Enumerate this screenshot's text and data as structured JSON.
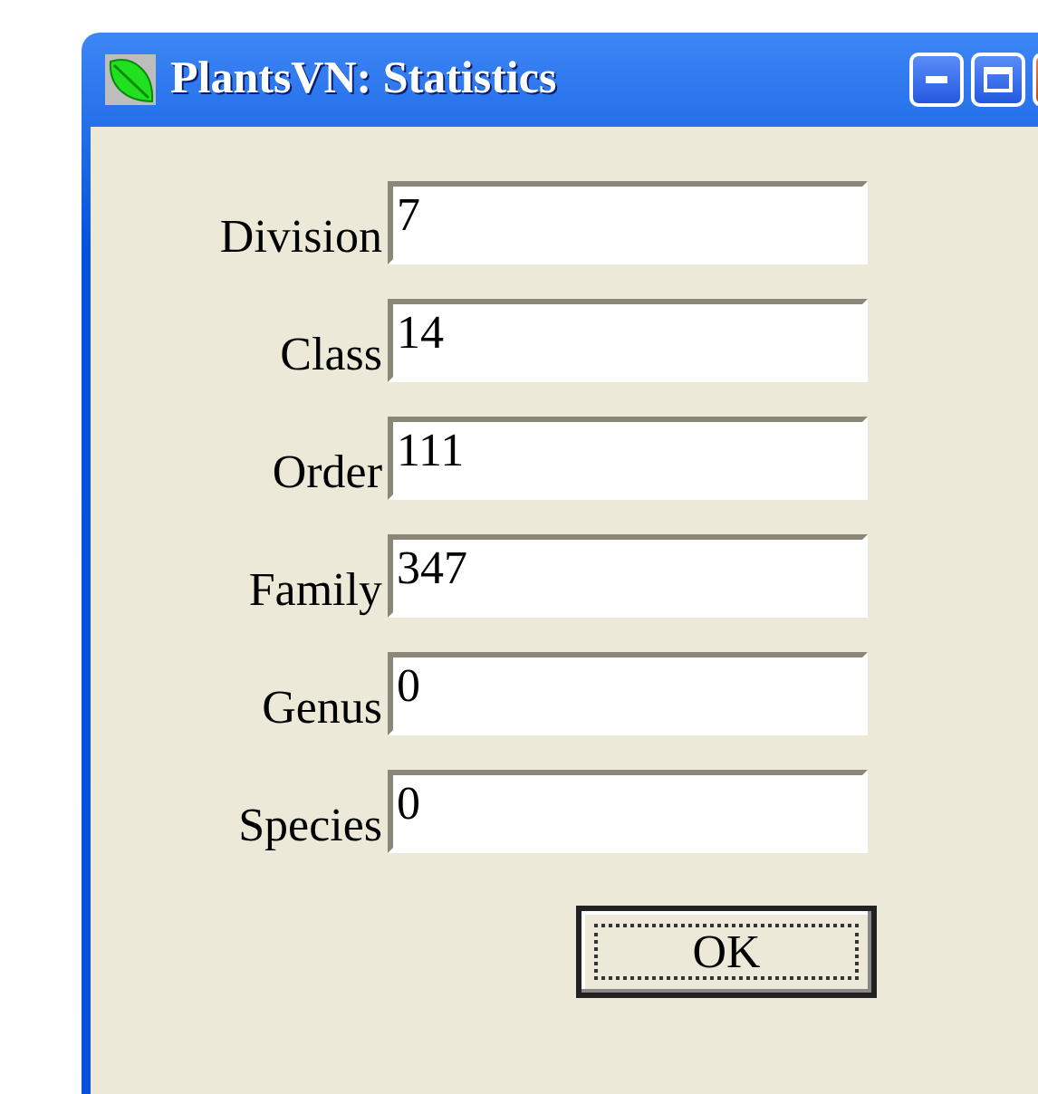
{
  "window": {
    "title": "PlantsVN: Statistics"
  },
  "fields": [
    {
      "label": "Division",
      "value": "7"
    },
    {
      "label": "Class",
      "value": "14"
    },
    {
      "label": "Order",
      "value": "111"
    },
    {
      "label": "Family",
      "value": "347"
    },
    {
      "label": "Genus",
      "value": "0"
    },
    {
      "label": "Species",
      "value": "0"
    }
  ],
  "buttons": [
    "OK"
  ]
}
